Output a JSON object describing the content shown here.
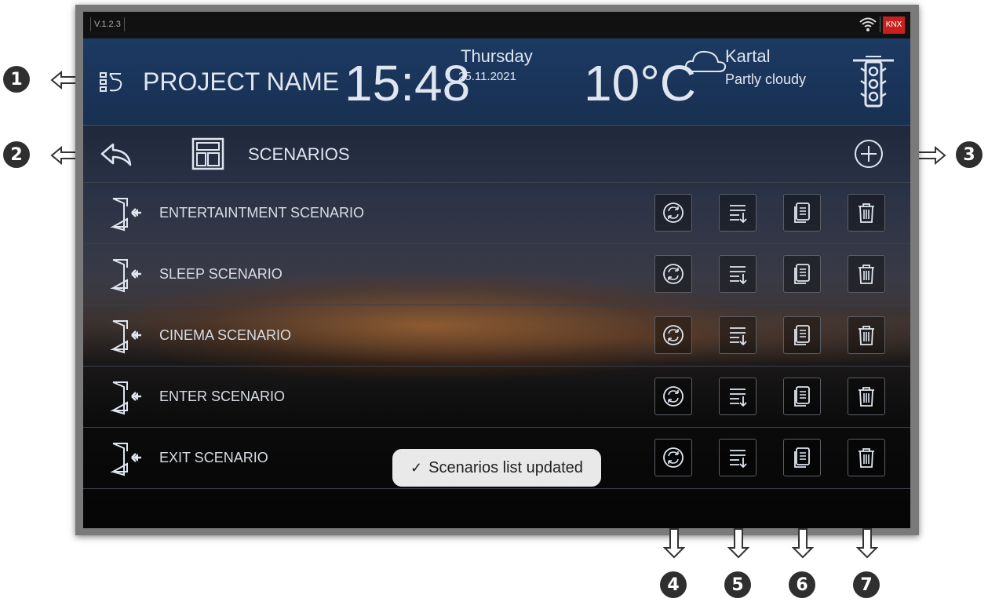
{
  "callouts": {
    "c1": "1",
    "c2": "2",
    "c3": "3",
    "c4": "4",
    "c5": "5",
    "c6": "6",
    "c7": "7"
  },
  "statusbar": {
    "version": "V.1.2.3",
    "badge": "KNX"
  },
  "header": {
    "project_name": "PROJECT NAME",
    "time": "15:48",
    "day": "Thursday",
    "date": "25.11.2021",
    "temperature": "10°C",
    "location": "Kartal",
    "weather": "Partly cloudy"
  },
  "toolbar": {
    "title": "SCENARIOS"
  },
  "scenarios": [
    {
      "label": "ENTERTAINTMENT SCENARIO"
    },
    {
      "label": "SLEEP SCENARIO"
    },
    {
      "label": "CINEMA SCENARIO"
    },
    {
      "label": "ENTER SCENARIO"
    },
    {
      "label": "EXIT SCENARIO"
    }
  ],
  "toast": {
    "message": "Scenarios list updated",
    "check": "✓"
  },
  "colors": {
    "header_bg": "#1d3a63",
    "knx_badge": "#c8201f",
    "toast_bg": "#e9e9e9"
  },
  "icons": {
    "menu": "menu-icon",
    "back": "back-arrow-icon",
    "layout": "layout-icon",
    "add": "plus-circle-icon",
    "scenario": "door-enter-icon",
    "run": "sync-icon",
    "order": "sort-icon",
    "copy": "copy-icon",
    "delete": "trash-icon"
  }
}
